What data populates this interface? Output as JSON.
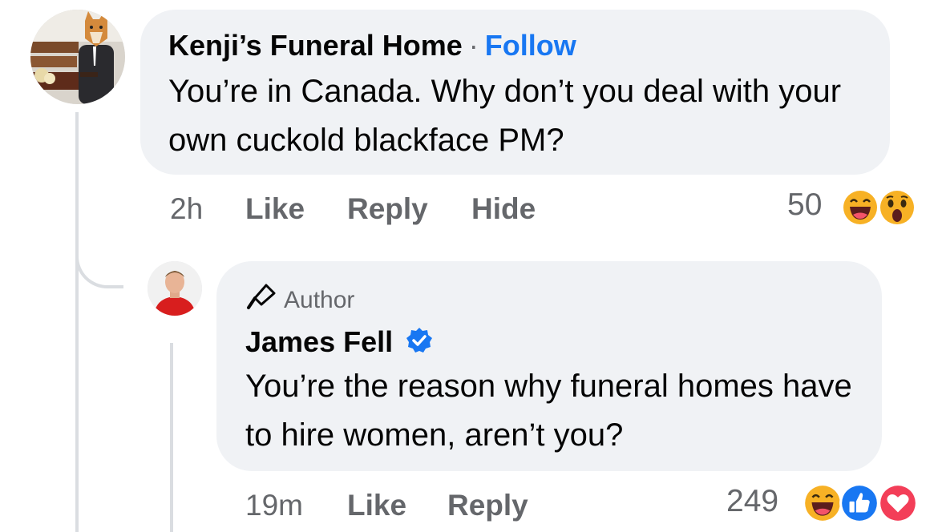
{
  "comment": {
    "author": "Kenji’s Funeral Home",
    "separator": "·",
    "follow_label": "Follow",
    "text": "You’re in Canada. Why don’t you deal with your own cuckold blackface PM?",
    "time": "2h",
    "like_label": "Like",
    "reply_label": "Reply",
    "hide_label": "Hide",
    "reaction_count": "50",
    "reactions": [
      "haha-icon",
      "wow-icon"
    ]
  },
  "reply": {
    "badge_label": "Author",
    "author": "James Fell",
    "verified": "verified-badge-icon",
    "text": "You’re the reason why funeral homes have to hire women, aren’t you?",
    "time": "19m",
    "like_label": "Like",
    "reply_label": "Reply",
    "reaction_count": "249",
    "reactions": [
      "haha-icon",
      "like-icon",
      "love-icon"
    ]
  },
  "colors": {
    "link_blue": "#1877f2",
    "bubble_bg": "#f0f2f5",
    "meta_gray": "#65676b",
    "love_red": "#f33e58",
    "emoji_yellow": "#f7b125"
  }
}
